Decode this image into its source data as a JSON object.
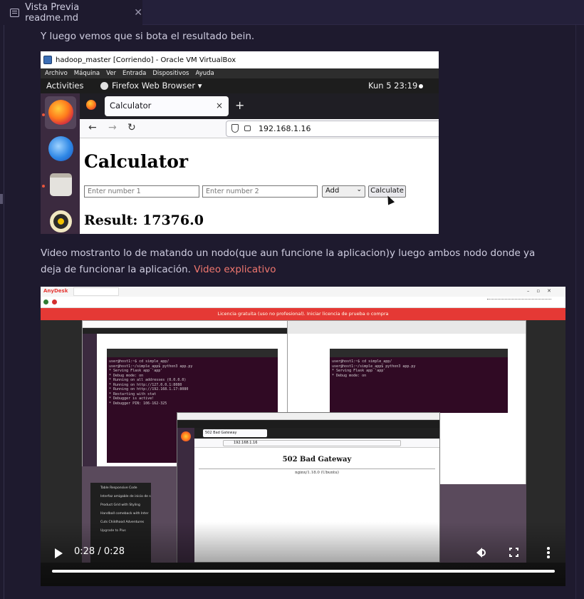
{
  "editor_tab": {
    "title": "Vista Previa readme.md",
    "close_glyph": "✕"
  },
  "content": {
    "paragraph1": "Y luego vemos que si bota el resultado bein.",
    "paragraph2_text": "Video mostranto lo de matando un nodo(que aun funcione la aplicacion)y luego ambos nodo donde ya deja de funcionar la aplicación. ",
    "paragraph2_link": "Video explicativo",
    "link_color": "#f0776f"
  },
  "screenshot1": {
    "window_title": "hadoop_master [Corriendo] - Oracle VM VirtualBox",
    "menu": [
      "Archivo",
      "Máquina",
      "Ver",
      "Entrada",
      "Dispositivos",
      "Ayuda"
    ],
    "gnome": {
      "activities": "Activities",
      "app": "Firefox Web Browser ▾",
      "clock": "Kun 5  23:19"
    },
    "browser_tab": "Calculator",
    "browser_tab_close": "×",
    "new_tab": "+",
    "nav": {
      "back": "←",
      "forward": "→",
      "reload": "↻"
    },
    "url": "192.168.1.16",
    "page": {
      "heading": "Calculator",
      "input1_placeholder": "Enter number 1",
      "input2_placeholder": "Enter number 2",
      "operation": "Add",
      "button": "Calculate",
      "result": "Result: 17376.0"
    }
  },
  "video": {
    "anydesk_logo": "AnyDesk",
    "banner": "Licencia gratuita (uso no profesional). Iniciar licencia de prueba o compra",
    "terminal_lines": [
      "user@host1:~$ cd simple_app/",
      "user@host1:~/simple_app$ python3 app.py",
      " * Serving Flask app 'app'",
      " * Debug mode: on",
      " * Running on all addresses (0.0.0.0)",
      " * Running on http://127.0.0.1:8080",
      " * Running on http://192.168.1.17:8080",
      " * Restarting with stat",
      " * Debugger is active!",
      " * Debugger PIN: 106-162-325"
    ],
    "remote_tab": "502 Bad Gateway",
    "remote_url": "192.168.1.16",
    "remote_heading": "502 Bad Gateway",
    "remote_server": "nginx/1.18.0 (Ubuntu)",
    "side_items": [
      "Table Responsive Code",
      "Interfaz amigable de inicio de s",
      "Product Grid with Styling",
      "Handball comeback with Inter",
      "Cuts Childhood Adventures",
      "Upgrade to Plus"
    ],
    "time": "0:28 / 0:28",
    "progress": 1.0
  }
}
